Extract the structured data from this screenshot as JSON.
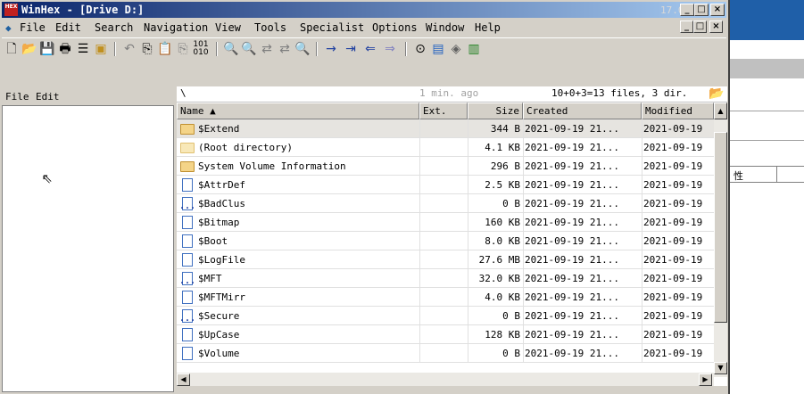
{
  "window": {
    "app_icon_text": "HEX",
    "title": "WinHex - [Drive D:]",
    "version": "17.0",
    "minimize": "_",
    "maximize": "□",
    "close": "×"
  },
  "menubar": {
    "items": [
      {
        "label": "File"
      },
      {
        "label": "Edit"
      },
      {
        "label": "Search"
      },
      {
        "label": "Navigation"
      },
      {
        "label": "View"
      },
      {
        "label": "Tools"
      },
      {
        "label": "Specialist"
      },
      {
        "label": "Options"
      },
      {
        "label": "Window"
      },
      {
        "label": "Help"
      }
    ],
    "mdi_minimize": "_",
    "mdi_restore": "□",
    "mdi_close": "×"
  },
  "toolbar": {
    "icons": [
      "new-file-icon",
      "open-folder-icon",
      "save-icon",
      "print-icon",
      "properties-icon",
      "open-disk-icon",
      "undo-icon",
      "copy-icon",
      "paste-icon",
      "paste-clipboard-icon",
      "convert-binary-icon",
      "find-icon",
      "find-hex-icon",
      "replace-text-icon",
      "replace-hex-icon",
      "find-next-icon",
      "goto-icon",
      "goto-offset-icon",
      "back-icon",
      "forward-icon",
      "disk-tools-icon",
      "data-interpreter-icon",
      "disk-icon",
      "ram-icon"
    ]
  },
  "left_pane": {
    "menu_file": "File",
    "menu_edit": "Edit"
  },
  "path_bar": {
    "path": "\\",
    "time": "1 min. ago",
    "summary": "10+0+3=13 files, 3 dir."
  },
  "file_list": {
    "columns": [
      {
        "label": "Name ▲"
      },
      {
        "label": "Ext."
      },
      {
        "label": "Size"
      },
      {
        "label": "Created"
      },
      {
        "label": "Modified"
      }
    ],
    "rows": [
      {
        "name": "$Extend",
        "ext": "",
        "size": "344 B",
        "created": "2021-09-19  21...",
        "modified": "2021-09-19",
        "icon": "folder-icon"
      },
      {
        "name": "(Root directory)",
        "ext": "",
        "size": "4.1 KB",
        "created": "2021-09-19  21...",
        "modified": "2021-09-19",
        "icon": "folder-icon"
      },
      {
        "name": "System Volume Information",
        "ext": "",
        "size": "296 B",
        "created": "2021-09-19  21...",
        "modified": "2021-09-19",
        "icon": "folder-icon"
      },
      {
        "name": "$AttrDef",
        "ext": "",
        "size": "2.5 KB",
        "created": "2021-09-19  21...",
        "modified": "2021-09-19",
        "icon": "file-icon"
      },
      {
        "name": "$BadClus",
        "ext": "",
        "size": "0 B",
        "created": "2021-09-19  21...",
        "modified": "2021-09-19",
        "icon": "file-icon"
      },
      {
        "name": "$Bitmap",
        "ext": "",
        "size": "160 KB",
        "created": "2021-09-19  21...",
        "modified": "2021-09-19",
        "icon": "file-icon"
      },
      {
        "name": "$Boot",
        "ext": "",
        "size": "8.0 KB",
        "created": "2021-09-19  21...",
        "modified": "2021-09-19",
        "icon": "file-icon"
      },
      {
        "name": "$LogFile",
        "ext": "",
        "size": "27.6 MB",
        "created": "2021-09-19  21...",
        "modified": "2021-09-19",
        "icon": "file-icon"
      },
      {
        "name": "$MFT",
        "ext": "",
        "size": "32.0 KB",
        "created": "2021-09-19  21...",
        "modified": "2021-09-19",
        "icon": "file-icon"
      },
      {
        "name": "$MFTMirr",
        "ext": "",
        "size": "4.0 KB",
        "created": "2021-09-19  21...",
        "modified": "2021-09-19",
        "icon": "file-icon"
      },
      {
        "name": "$Secure",
        "ext": "",
        "size": "0 B",
        "created": "2021-09-19  21...",
        "modified": "2021-09-19",
        "icon": "file-icon"
      },
      {
        "name": "$UpCase",
        "ext": "",
        "size": "128 KB",
        "created": "2021-09-19  21...",
        "modified": "2021-09-19",
        "icon": "file-icon"
      },
      {
        "name": "$Volume",
        "ext": "",
        "size": "0 B",
        "created": "2021-09-19  21...",
        "modified": "2021-09-19",
        "icon": "file-icon"
      }
    ]
  },
  "background_window": {
    "cell_text": "性"
  },
  "colors": {
    "title_start": "#0a246a",
    "title_end": "#a6caf0",
    "face": "#d4d0c8",
    "folder": "#f4d488"
  }
}
